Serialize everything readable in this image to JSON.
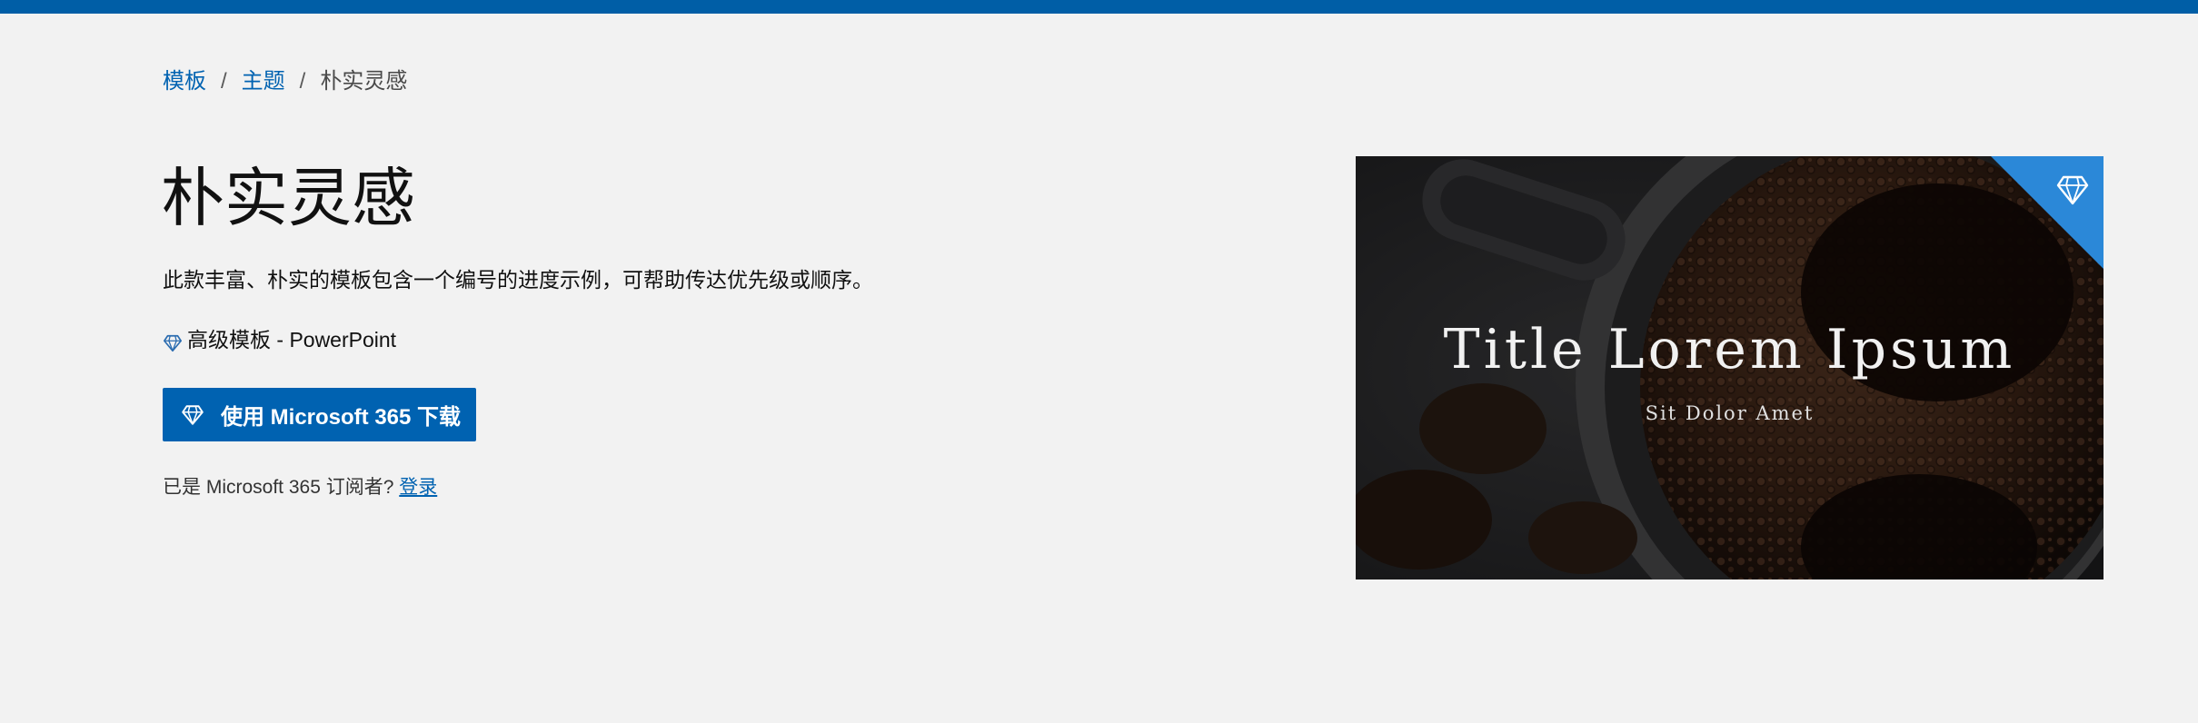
{
  "colors": {
    "accent": "#005ea6",
    "button": "#0062b1",
    "link": "#0062b1",
    "background": "#f2f2f2",
    "premium_corner": "#2b88d8"
  },
  "breadcrumb": {
    "items": [
      {
        "label": "模板",
        "link": true
      },
      {
        "label": "主题",
        "link": true
      },
      {
        "label": "朴实灵感",
        "link": false
      }
    ],
    "separator": "/"
  },
  "page": {
    "title": "朴实灵感",
    "description": "此款丰富、朴实的模板包含一个编号的进度示例，可帮助传达优先级或顺序。",
    "premium_label": "高级模板 - PowerPoint",
    "premium_icon": "diamond-icon"
  },
  "download_button": {
    "label": "使用 Microsoft 365 下载",
    "icon": "diamond-icon"
  },
  "subscriber": {
    "text": "已是 Microsoft 365 订阅者? ",
    "signin_label": "登录"
  },
  "preview": {
    "title": "Title Lorem Ipsum",
    "subtitle": "Sit Dolor Amet",
    "corner_icon": "diamond-icon"
  }
}
